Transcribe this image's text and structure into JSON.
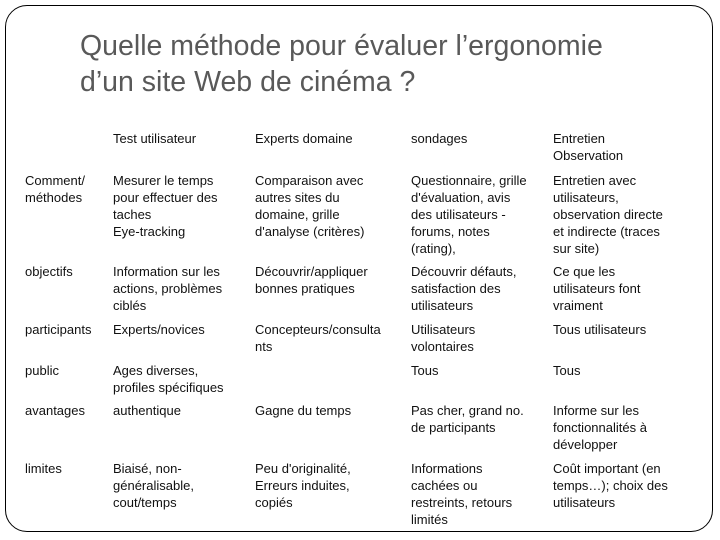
{
  "title": {
    "line1": "Quelle méthode pour évaluer  l’ergonomie",
    "line2": "d’un site Web de cinéma ?"
  },
  "table": {
    "headers": [
      "",
      "Test utilisateur",
      "Experts domaine",
      "sondages",
      "Entretien\nObservation"
    ],
    "rows": [
      {
        "label": "Comment/\nméthodes",
        "cells": [
          "Mesurer le temps\npour effectuer des\ntaches\nEye-tracking",
          "Comparaison avec\nautres sites du\ndomaine, grille\nd'analyse (critères)",
          "Questionnaire, grille\nd'évaluation, avis\ndes utilisateurs -\nforums, notes\n(rating),",
          "Entretien avec\nutilisateurs,\nobservation directe\net indirecte (traces\nsur site)"
        ]
      },
      {
        "label": "objectifs",
        "cells": [
          "Information sur les\nactions, problèmes\nciblés",
          "Découvrir/appliquer\nbonnes pratiques",
          "Découvrir défauts,\nsatisfaction des\nutilisateurs",
          "Ce que les\nutilisateurs font\nvraiment"
        ]
      },
      {
        "label": "participants",
        "cells": [
          "Experts/novices",
          "Concepteurs/consulta\nnts",
          "Utilisateurs\nvolontaires",
          "Tous utilisateurs"
        ]
      },
      {
        "label": "public",
        "cells": [
          "Ages diverses,\nprofiles spécifiques",
          "",
          "Tous",
          "Tous"
        ]
      },
      {
        "label": "avantages",
        "cells": [
          "authentique",
          "Gagne du temps",
          "Pas cher, grand no.\nde participants",
          "Informe sur les\nfonctionnalités à\ndévelopper"
        ]
      },
      {
        "label": "limites",
        "cells": [
          "Biaisé, non-\ngénéralisable,\ncout/temps",
          "Peu d'originalité,\nErreurs induites,\ncopiés",
          "Informations\ncachées ou\nrestreints, retours\nlimités",
          "Coût important (en\ntemps…); choix des\nutilisateurs"
        ]
      }
    ]
  }
}
